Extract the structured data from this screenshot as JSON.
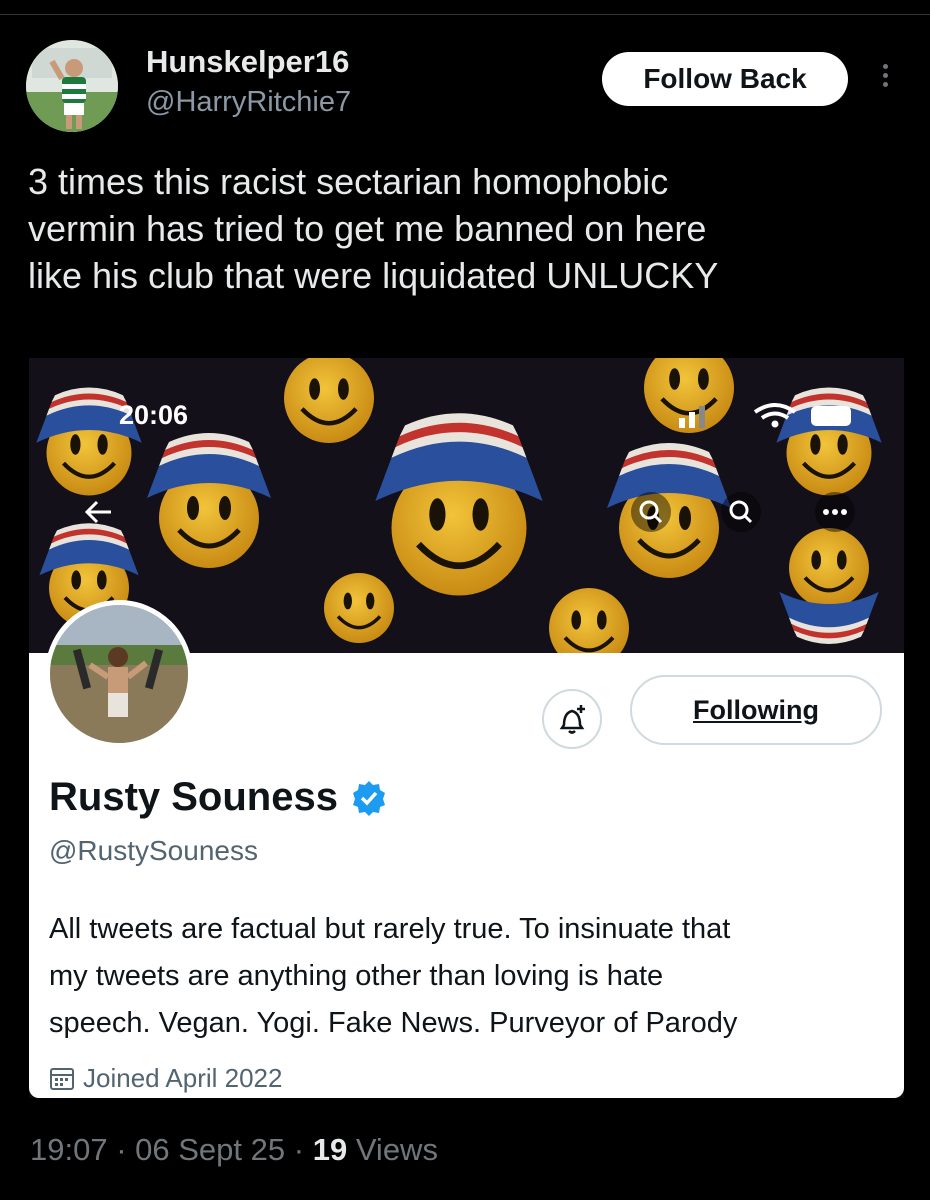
{
  "tweet": {
    "author_name": "Hunskelper16",
    "author_handle": "@HarryRitchie7",
    "follow_label": "Follow Back",
    "text_lines": [
      "3 times this racist sectarian homophobic",
      "vermin has tried to get me banned on here",
      "like his club that were liquidated UNLUCKY"
    ],
    "time": "19:07",
    "date": "06 Sept 25",
    "views_count": "19",
    "views_label": "Views",
    "separator": "·"
  },
  "screenshot": {
    "status_time": "20:06",
    "profile": {
      "name": "Rusty Souness",
      "handle": "@RustySouness",
      "following_label": "Following",
      "bio_lines": [
        "All tweets are factual but rarely true. To insinuate that",
        "my tweets are anything other than loving is hate",
        "speech. Vegan. Yogi. Fake News. Purveyor of Parody"
      ],
      "joined": "Joined April 2022"
    }
  },
  "icons": {
    "more": "more-vertical-icon",
    "back": "back-arrow-icon",
    "search": "search-icon",
    "more_horizontal": "more-horizontal-icon",
    "notifications": "bell-plus-icon",
    "verified": "verified-badge-icon",
    "calendar": "calendar-icon"
  },
  "colors": {
    "background": "#000000",
    "accent_verified": "#1d9bf0",
    "muted_text": "#71767b"
  }
}
